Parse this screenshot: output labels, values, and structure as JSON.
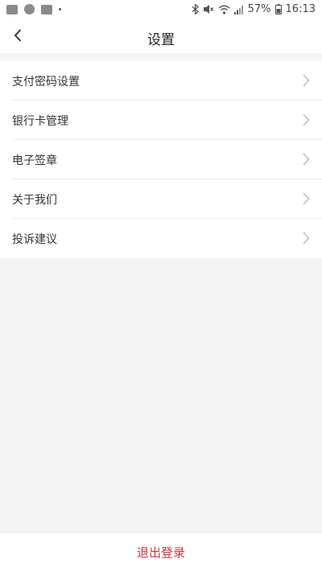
{
  "status_bar": {
    "battery": "57%",
    "time": "16:13"
  },
  "header": {
    "title": "设置"
  },
  "menu": {
    "items": [
      {
        "label": "支付密码设置"
      },
      {
        "label": "银行卡管理"
      },
      {
        "label": "电子签章"
      },
      {
        "label": "关于我们"
      },
      {
        "label": "投诉建议"
      }
    ]
  },
  "footer": {
    "logout_label": "退出登录"
  },
  "colors": {
    "accent": "#d0343c",
    "background": "#f4f4f4"
  }
}
